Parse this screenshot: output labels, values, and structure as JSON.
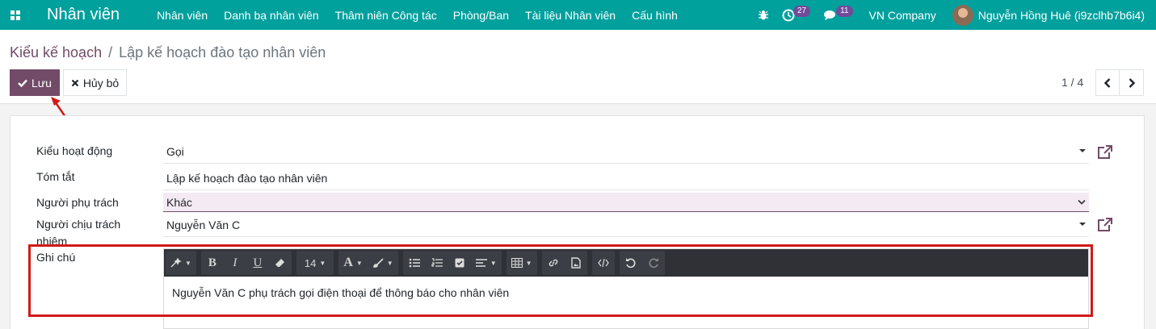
{
  "navbar": {
    "brand": "Nhân viên",
    "menu": [
      "Nhân viên",
      "Danh bạ nhân viên",
      "Thâm niên Công tác",
      "Phòng/Ban",
      "Tài liệu Nhân viên",
      "Cấu hình"
    ],
    "activity_count": "27",
    "message_count": "11",
    "company": "VN Company",
    "user": "Nguyễn Hồng Huê (i9zclhb7b6i4)",
    "accent_color": "#00A09D"
  },
  "breadcrumb": {
    "parent": "Kiểu kế hoạch",
    "separator": "/",
    "current": "Lập kế hoạch đào tạo nhân viên"
  },
  "actions": {
    "save_label": "Lưu",
    "discard_label": "Hủy bỏ",
    "primary_color": "#714B67"
  },
  "pager": {
    "value": "1 / 4"
  },
  "form": {
    "activity_type_label": "Kiểu hoạt động",
    "activity_type_value": "Gọi",
    "summary_label": "Tóm tắt",
    "summary_value": "Lập kế hoạch đào tạo nhân viên",
    "assignment_label": "Người phụ trách",
    "assignment_value": "Khác",
    "responsible_label": "Người chịu trách nhiệm",
    "responsible_value": "Nguyễn Văn C",
    "note_label": "Ghi chú",
    "note_value": "Nguyễn Văn C phụ trách gọi điện thoại để thông báo cho nhân viên"
  },
  "editor_toolbar": {
    "font_size": "14"
  }
}
